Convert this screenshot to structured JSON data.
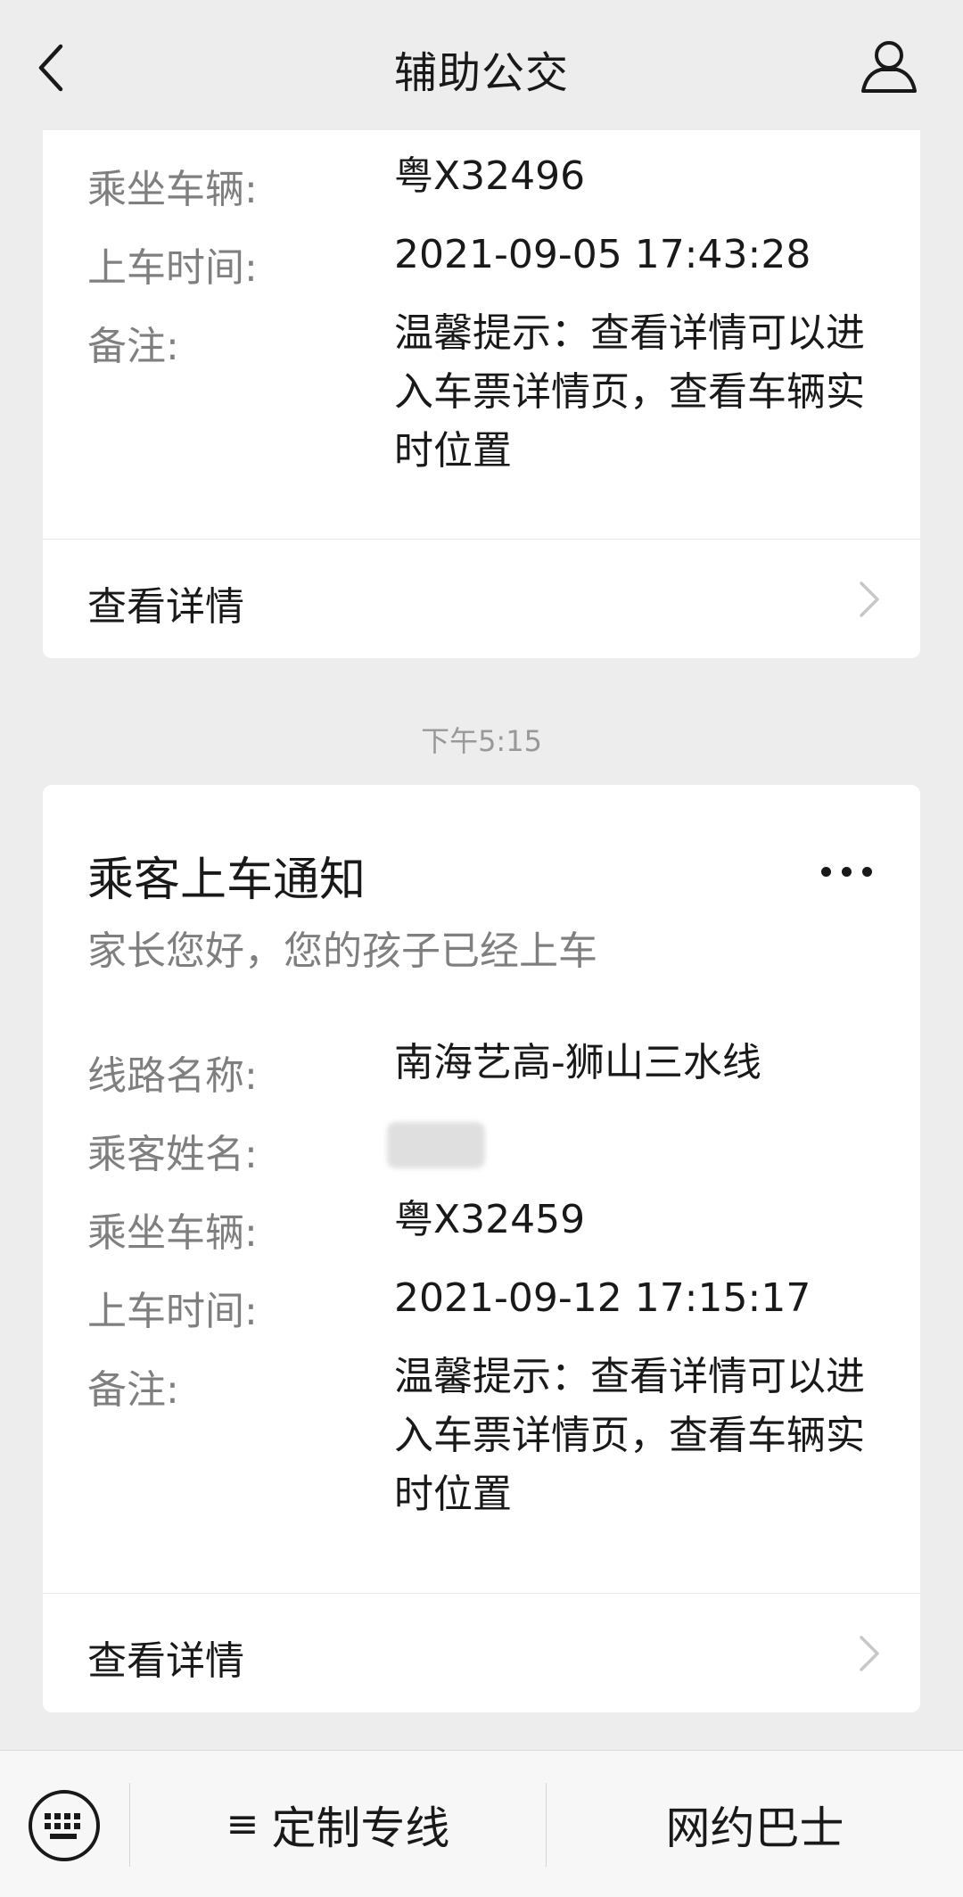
{
  "header": {
    "title": "辅助公交"
  },
  "card_top": {
    "rows": [
      {
        "label": "乘坐车辆:",
        "value": "粤X32496"
      },
      {
        "label": "上车时间:",
        "value": "2021-09-05 17:43:28"
      },
      {
        "label": "备注:",
        "value": "温馨提示：查看详情可以进入车票详情页，查看车辆实时位置"
      }
    ],
    "detail_label": "查看详情"
  },
  "timestamp": "下午5:15",
  "card_bottom": {
    "title": "乘客上车通知",
    "subtitle": "家长您好，您的孩子已经上车",
    "rows": [
      {
        "label": "线路名称:",
        "value": "南海艺高-狮山三水线"
      },
      {
        "label": "乘客姓名:",
        "value": ""
      },
      {
        "label": "乘坐车辆:",
        "value": "粤X32459"
      },
      {
        "label": "上车时间:",
        "value": "2021-09-12 17:15:17"
      },
      {
        "label": "备注:",
        "value": "温馨提示：查看详情可以进入车票详情页，查看车辆实时位置"
      }
    ],
    "detail_label": "查看详情"
  },
  "bottom_menu": {
    "items": [
      {
        "label": "定制专线",
        "glyph": "≡"
      },
      {
        "label": "网约巴士"
      }
    ]
  },
  "icons": {
    "back": "chevron-left-icon",
    "user": "user-icon",
    "more": "more-dots-icon",
    "keyboard": "keyboard-icon",
    "chevron": "chevron-right-icon"
  }
}
